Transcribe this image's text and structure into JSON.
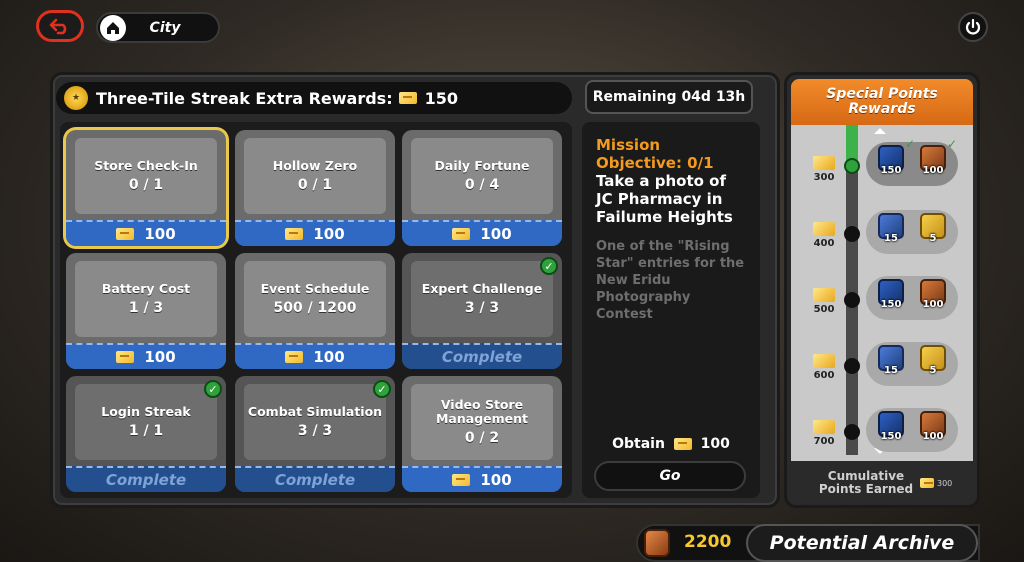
{
  "nav": {
    "city_label": "City"
  },
  "panel": {
    "title": "Three-Tile Streak Extra Rewards:",
    "title_amount": "150",
    "tiles": [
      {
        "name": "Store Check-In",
        "progress": "0 / 1",
        "reward": "100",
        "complete": false
      },
      {
        "name": "Hollow Zero",
        "progress": "0 / 1",
        "reward": "100",
        "complete": false
      },
      {
        "name": "Daily Fortune",
        "progress": "0 / 4",
        "reward": "100",
        "complete": false
      },
      {
        "name": "Battery Cost",
        "progress": "1 / 3",
        "reward": "100",
        "complete": false
      },
      {
        "name": "Event Schedule",
        "progress": "500 / 1200",
        "reward": "100",
        "complete": false
      },
      {
        "name": "Expert Challenge",
        "progress": "3 / 3",
        "reward": "Complete",
        "complete": true
      },
      {
        "name": "Login Streak",
        "progress": "1 / 1",
        "reward": "Complete",
        "complete": true
      },
      {
        "name": "Combat Simulation",
        "progress": "3 / 3",
        "reward": "Complete",
        "complete": true
      },
      {
        "name": "Video Store Management",
        "progress": "0 / 2",
        "reward": "100",
        "complete": false
      }
    ]
  },
  "mission": {
    "remaining": "Remaining 04d 13h",
    "heading": "Mission",
    "objective": "Objective: 0/1",
    "task": "Take a photo of JC Pharmacy in Failume Heights",
    "description": "One of the \"Rising Star\" entries for the New Eridu Photography Contest",
    "obtain_label": "Obtain",
    "obtain_amount": "100",
    "go_label": "Go"
  },
  "special_points": {
    "title_line1": "Special Points",
    "title_line2": "Rewards",
    "tiers": [
      {
        "threshold": "300",
        "reached": true,
        "rewards": [
          {
            "type": "film",
            "qty": "150",
            "claimed": true
          },
          {
            "type": "copper",
            "qty": "100",
            "claimed": true
          }
        ]
      },
      {
        "threshold": "400",
        "reached": false,
        "rewards": [
          {
            "type": "card",
            "qty": "15",
            "claimed": false
          },
          {
            "type": "gold",
            "qty": "5",
            "claimed": false
          }
        ]
      },
      {
        "threshold": "500",
        "reached": false,
        "rewards": [
          {
            "type": "film",
            "qty": "150",
            "claimed": false
          },
          {
            "type": "copper",
            "qty": "100",
            "claimed": false
          }
        ]
      },
      {
        "threshold": "600",
        "reached": false,
        "rewards": [
          {
            "type": "card",
            "qty": "15",
            "claimed": false
          },
          {
            "type": "gold",
            "qty": "5",
            "claimed": false
          }
        ]
      },
      {
        "threshold": "700",
        "reached": false,
        "rewards": [
          {
            "type": "film",
            "qty": "150",
            "claimed": false
          },
          {
            "type": "copper",
            "qty": "100",
            "claimed": false
          }
        ]
      }
    ],
    "cumulative_line1": "Cumulative",
    "cumulative_line2": "Points Earned",
    "cumulative_amount": "300"
  },
  "footer": {
    "currency_amount": "2200",
    "archive_label": "Potential Archive"
  },
  "colors": {
    "accent_orange": "#f39a1f",
    "reward_blue": "#2f69c4",
    "complete_green": "#2fa23b",
    "selected_gold": "#e9c84a"
  }
}
